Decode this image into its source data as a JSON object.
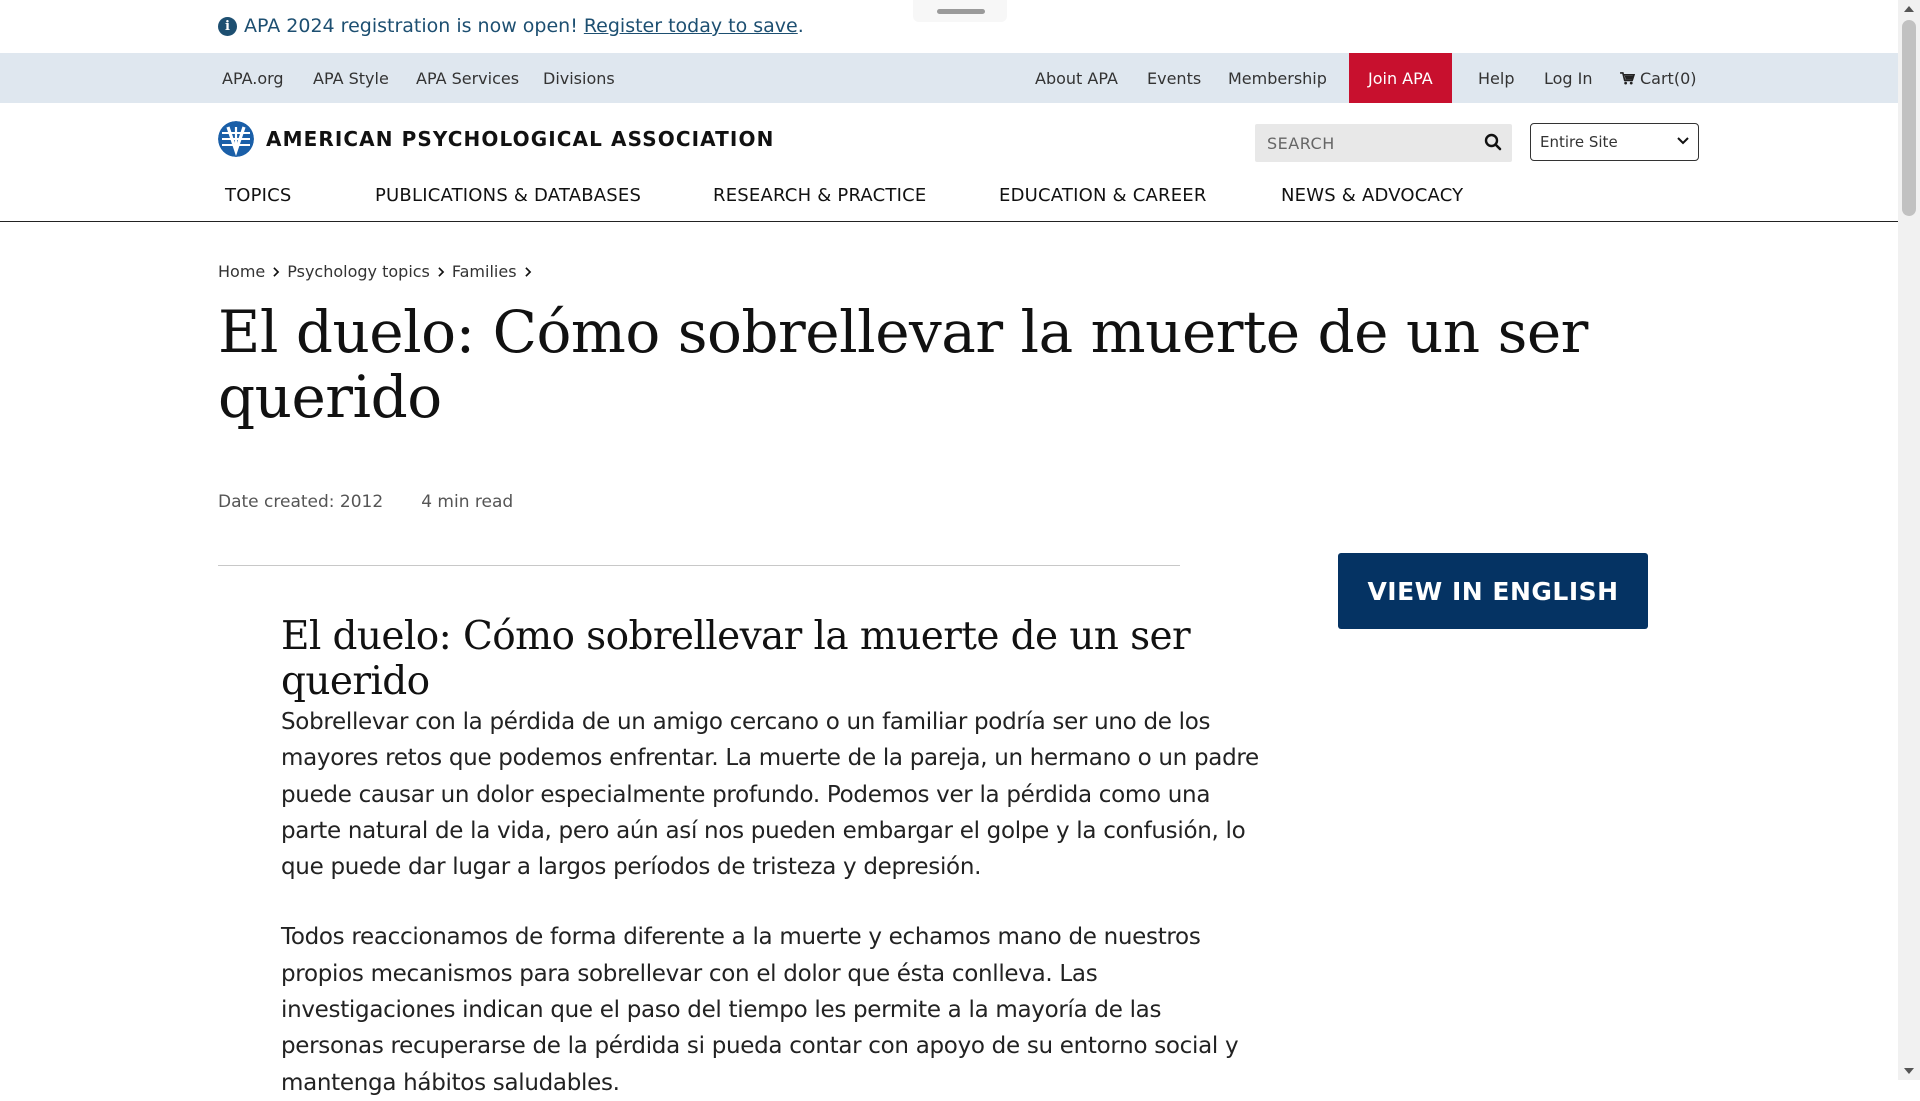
{
  "alert": {
    "text": "APA 2024 registration is now open!",
    "link": "Register today to save",
    "suffix": "."
  },
  "utility_nav": {
    "left": [
      "APA.org",
      "APA Style",
      "APA Services",
      "Divisions"
    ],
    "right": [
      "About APA",
      "Events",
      "Membership"
    ],
    "join": "Join APA",
    "help": "Help",
    "login": "Log In",
    "cart": "Cart(0)"
  },
  "brand": {
    "name": "AMERICAN PSYCHOLOGICAL ASSOCIATION"
  },
  "search": {
    "placeholder": "SEARCH",
    "scope": "Entire Site"
  },
  "main_nav": [
    "TOPICS",
    "PUBLICATIONS & DATABASES",
    "RESEARCH & PRACTICE",
    "EDUCATION & CAREER",
    "NEWS & ADVOCACY"
  ],
  "breadcrumb": [
    "Home",
    "Psychology topics",
    "Families"
  ],
  "page": {
    "title": "El duelo: Cómo sobrellevar la muerte de un ser querido",
    "date_created": "Date created: 2012",
    "read_time": "4 min read",
    "view_english": "VIEW IN ENGLISH"
  },
  "article": {
    "heading": "El duelo: Cómo sobrellevar la muerte de un ser querido",
    "paragraphs": [
      "Sobrellevar con la pérdida de un amigo cercano o un familiar podría ser uno de los mayores retos que podemos enfrentar. La muerte de la pareja, un hermano o un padre puede causar un dolor especialmente profundo. Podemos ver la pérdida como una parte natural de la vida, pero aún así nos pueden embargar el golpe y la confusión, lo que puede dar lugar a largos períodos de tristeza y depresión.",
      "Todos reaccionamos de forma diferente a la muerte y echamos mano de nuestros propios mecanismos para sobrellevar con el dolor que ésta conlleva. Las investigaciones indican que el paso del tiempo les permite a la mayoría de las personas recuperarse de la pérdida si pueda contar con apoyo de su entorno social y mantenga hábitos saludables."
    ]
  },
  "colors": {
    "alert_text": "#1d4f71",
    "utility_bg": "#dfe7ef",
    "join_bg": "#c8102e",
    "button_navy": "#053363",
    "logo_blue": "#1a5fa8"
  },
  "icons": [
    "info-icon",
    "cart-icon",
    "search-icon",
    "chevron-down-icon",
    "chevron-right-icon",
    "apa-logo-icon"
  ]
}
